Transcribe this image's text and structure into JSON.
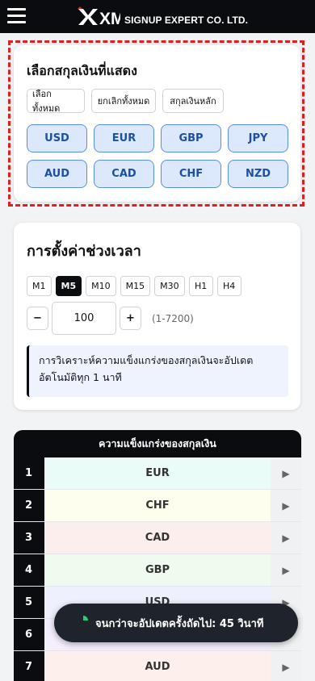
{
  "header": {
    "brand_name": "XM",
    "brand_text": "SIGNUP EXPERT CO. LTD.",
    "menu_icon": "hamburger-menu-icon"
  },
  "currency_selector": {
    "title": "เลือกสกุลเงินที่แสดง",
    "select_all_label": "เลือกทั้งหมด",
    "deselect_all_label": "ยกเลิกทั้งหมด",
    "major_label": "สกุลเงินหลัก",
    "currencies": [
      "USD",
      "EUR",
      "GBP",
      "JPY",
      "AUD",
      "CAD",
      "CHF",
      "NZD"
    ],
    "highlight_color": "#e0201e"
  },
  "timeframe": {
    "title": "การตั้งค่าช่วงเวลา",
    "options": [
      "M1",
      "M5",
      "M10",
      "M15",
      "M30",
      "H1",
      "H4"
    ],
    "active": "M5",
    "minus_label": "−",
    "plus_label": "+",
    "period_value": "100",
    "range_hint": "(1-7200)",
    "info_text": "การวิเคราะห์ความแข็งแกร่งของสกุลเงินจะอัปเดตอัตโนมัติทุก 1 นาที"
  },
  "strength_table": {
    "title": "ความแข็งแกร่งของสกุลเงิน",
    "rows": [
      {
        "rank": "1",
        "currency": "EUR",
        "color": "#eafcf8"
      },
      {
        "rank": "2",
        "currency": "CHF",
        "color": "#fefeee"
      },
      {
        "rank": "3",
        "currency": "CAD",
        "color": "#fdeeee"
      },
      {
        "rank": "4",
        "currency": "GBP",
        "color": "#eefbee"
      },
      {
        "rank": "5",
        "currency": "USD",
        "color": "#eef1fd"
      },
      {
        "rank": "6",
        "currency": "",
        "color": "#f4eefd"
      },
      {
        "rank": "7",
        "currency": "AUD",
        "color": "#fdefeb"
      }
    ],
    "arrow": "▶"
  },
  "toast": {
    "text": "จนกว่าจะอัปเดตครั้งถัดไป: 45 วินาที",
    "progress": 0.25,
    "icon": "countdown-pie-icon",
    "accent": "#2ecc71"
  }
}
